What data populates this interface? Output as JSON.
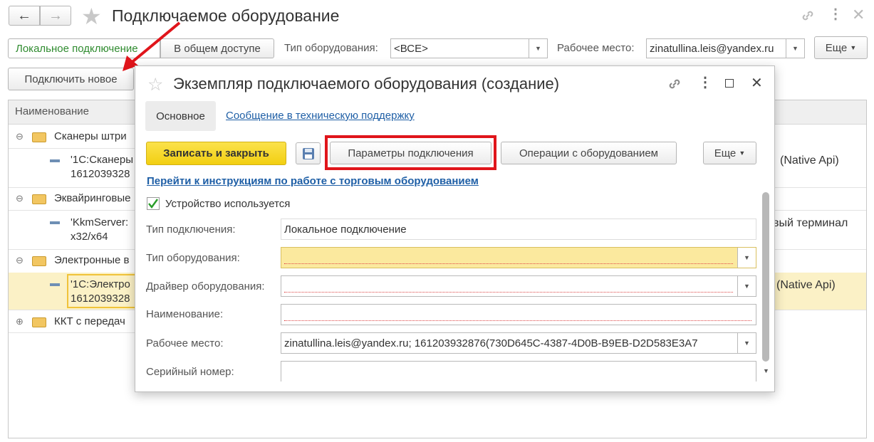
{
  "app": {
    "title": "Подключаемое оборудование",
    "nav": {
      "back": "←",
      "forward": "→"
    },
    "filters": {
      "local_tab": "Локальное подключение",
      "shared_tab": "В общем доступе",
      "equipment_type_label": "Тип оборудования:",
      "equipment_type_value": "<ВСЕ>",
      "workplace_label": "Рабочее место:",
      "workplace_value": "zinatullina.leis@yandex.ru",
      "more": "Еще"
    },
    "connect_new": "Подключить новое",
    "table": {
      "header": "Наименование",
      "groups": [
        {
          "name": "Сканеры штри",
          "item": "'1С:Сканеры",
          "item2": "1612039328",
          "right": "(Native Api)"
        },
        {
          "name": "Эквайринговые",
          "item": "'KkmServer:",
          "item2": "x32/x64",
          "right": "вый терминал"
        },
        {
          "name": "Электронные в",
          "item": "'1С:Электро",
          "item2": "1612039328",
          "right": "(Native Api)"
        },
        {
          "name": "ККТ с передач"
        }
      ]
    }
  },
  "dialog": {
    "title": "Экземпляр подключаемого оборудования (создание)",
    "tabs": {
      "main": "Основное",
      "support": "Сообщение в техническую поддержку"
    },
    "toolbar": {
      "save_close": "Записать и закрыть",
      "params": "Параметры подключения",
      "operations": "Операции с оборудованием",
      "more": "Еще"
    },
    "instructions_link": "Перейти к инструкциям по работе с торговым оборудованием",
    "device_used": "Устройство используется",
    "fields": {
      "connection_type_label": "Тип подключения:",
      "connection_type_value": "Локальное подключение",
      "equipment_type_label": "Тип оборудования:",
      "equipment_type_value": "",
      "driver_label": "Драйвер оборудования:",
      "driver_value": "",
      "name_label": "Наименование:",
      "name_value": "",
      "workplace_label": "Рабочее место:",
      "workplace_value": "zinatullina.leis@yandex.ru; 161203932876(730D645C-4387-4D0B-B9EB-D2D583E3A7",
      "serial_label": "Серийный номер:",
      "serial_value": ""
    }
  },
  "colors": {
    "accent_yellow": "#f8d924",
    "highlight_row": "#fbf1c6",
    "link": "#1f5fa6",
    "annotation_red": "#e0151b",
    "checkbox_green": "#2a9d2a"
  }
}
